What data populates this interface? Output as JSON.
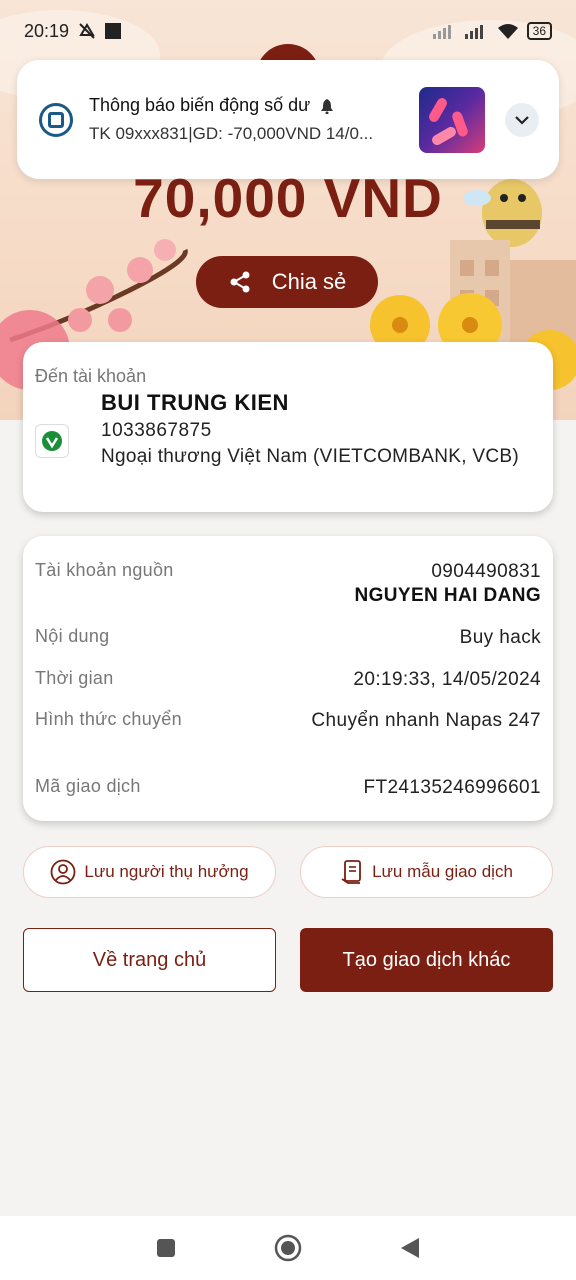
{
  "status_bar": {
    "time": "20:19",
    "battery": "36",
    "icons": [
      "mute-icon",
      "square-icon",
      "signal-icon",
      "signal-icon",
      "wifi-icon",
      "battery-icon"
    ]
  },
  "notification": {
    "title": "Thông báo biến động số dư",
    "body": "TK 09xxx831|GD: -70,000VND 14/0...",
    "icons": [
      "app-icon",
      "bell-icon",
      "thumbnail-image",
      "chevron-down-icon"
    ]
  },
  "transfer": {
    "amount": "70,000 VND",
    "share_label": "Chia sẻ"
  },
  "destination": {
    "label": "Đến tài khoản",
    "name": "BUI TRUNG KIEN",
    "account_number": "1033867875",
    "bank": "Ngoại thương Việt Nam (VIETCOMBANK, VCB)"
  },
  "details": {
    "source_label": "Tài khoản nguồn",
    "source_number": "0904490831",
    "source_name": "NGUYEN HAI DANG",
    "content_label": "Nội dung",
    "content_value": "Buy hack",
    "time_label": "Thời gian",
    "time_value": "20:19:33, 14/05/2024",
    "method_label": "Hình thức chuyển",
    "method_value": "Chuyển nhanh Napas 247",
    "txn_label": "Mã giao dịch",
    "txn_value": "FT24135246996601"
  },
  "actions": {
    "save_beneficiary": "Lưu người thụ hưởng",
    "save_template": "Lưu mẫu giao dịch",
    "home": "Về trang chủ",
    "new_transaction": "Tạo giao dịch khác"
  },
  "colors": {
    "accent": "#7a1f12",
    "hero_bg": "#f6dcc8",
    "page_bg": "#f4f3f2"
  }
}
